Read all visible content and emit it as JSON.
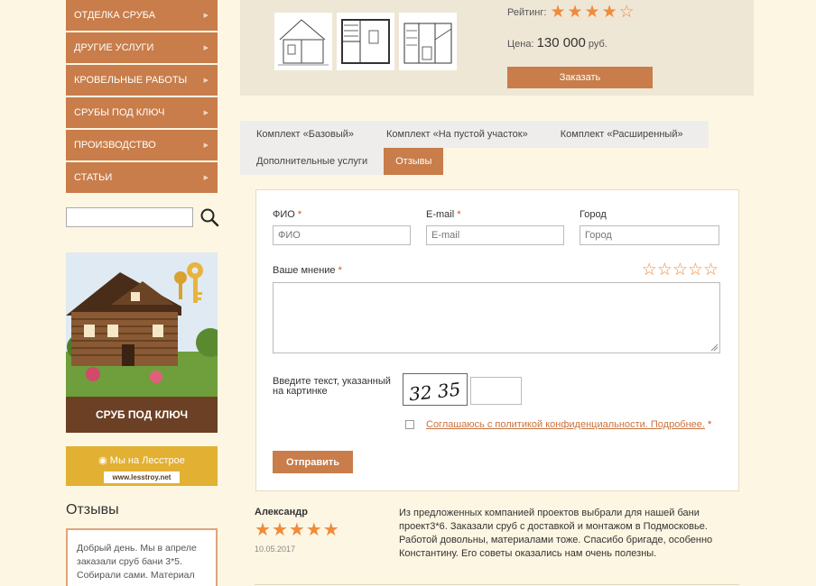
{
  "sidebar": {
    "menu": [
      {
        "label": "ОТДЕЛКА СРУБА"
      },
      {
        "label": "ДРУГИЕ УСЛУГИ"
      },
      {
        "label": "КРОВЕЛЬНЫЕ РАБОТЫ"
      },
      {
        "label": "СРУБЫ ПОД КЛЮЧ"
      },
      {
        "label": "ПРОИЗВОДСТВО"
      },
      {
        "label": "СТАТЬИ"
      }
    ],
    "search_value": "",
    "promo_caption": "СРУБ ПОД КЛЮЧ",
    "lesstroy_line1": "Мы на Лесстрое",
    "lesstroy_line2": "www.lesstroy.net",
    "reviews_title": "Отзывы",
    "review_excerpt": "Добрый день. Мы в апреле заказали сруб бани 3*5. Собирали сами. Материал"
  },
  "product": {
    "rating_label": "Рейтинг:",
    "rating_value": 4,
    "rating_max": 5,
    "price_label": "Цена:",
    "price_value": "130 000",
    "price_unit": "руб.",
    "order_label": "Заказать"
  },
  "tabs": {
    "row1": [
      "Комплект «Базовый»",
      "Комплект «На пустой участок»",
      "Комплект «Расширенный»"
    ],
    "row2": [
      "Дополнительные услуги",
      "Отзывы"
    ],
    "active": "Отзывы"
  },
  "form": {
    "name_label": "ФИО",
    "name_placeholder": "ФИО",
    "email_label": "E-mail",
    "email_placeholder": "E-mail",
    "city_label": "Город",
    "city_placeholder": "Город",
    "opinion_label": "Ваше мнение",
    "required_mark": "*",
    "captcha_label": "Введите текст, указанный на картинке",
    "captcha_text": "32 35",
    "agree_text": "Соглашаюсь с политикой конфиденциальности. Подробнее.",
    "submit_label": "Отправить"
  },
  "review": {
    "author": "Александр",
    "stars": 5,
    "date": "10.05.2017",
    "text": "Из предложенных компанией проектов выбрали для нашей бани проект3*6. Заказали сруб с доставкой и монтажом в Подмосковье. Работой довольны, материалами тоже. Спасибо бригаде, особенно Константину. Его советы оказались нам очень полезны."
  },
  "colors": {
    "accent": "#c87d4a",
    "star": "#f08b3c",
    "page_bg": "#fdf6e2"
  }
}
